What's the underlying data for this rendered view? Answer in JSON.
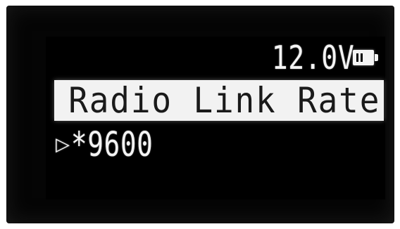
{
  "status": {
    "voltage": "12.0V",
    "battery_icon": "battery-icon"
  },
  "menu": {
    "title": "Radio Link Rate",
    "cursor_icon": "play-triangle-icon",
    "cursor_glyph": "▷",
    "selected_option": "*9600"
  },
  "colors": {
    "screen_background": "#000000",
    "pixel_on": "#f4f4f4",
    "title_bar": "#f2f2f2"
  }
}
